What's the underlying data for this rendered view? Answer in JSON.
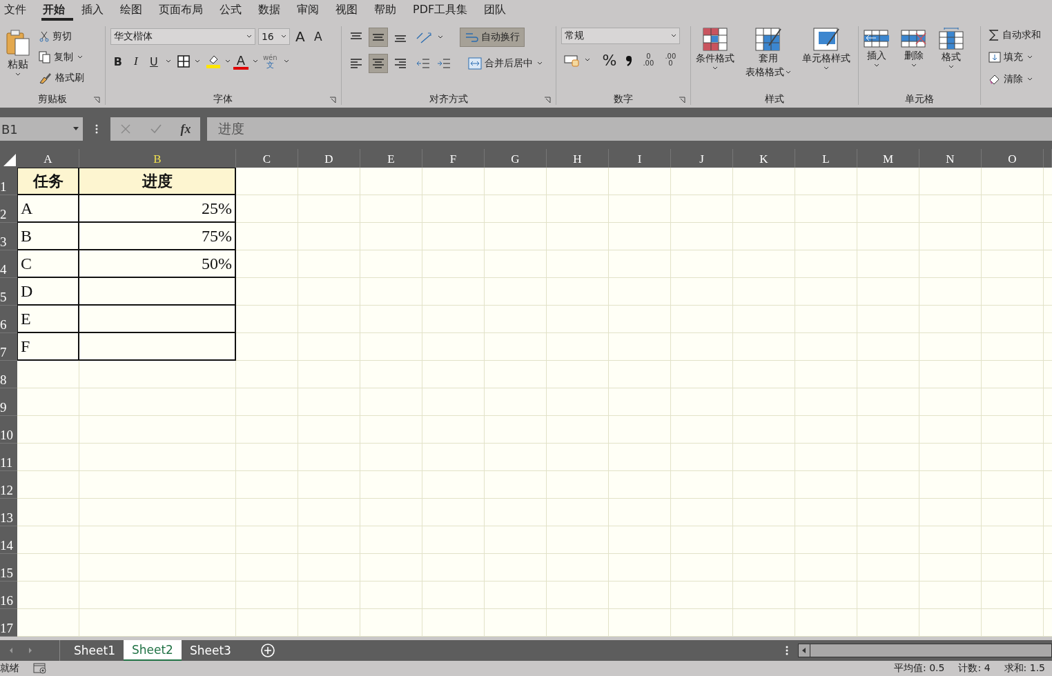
{
  "menu_tabs": [
    {
      "label": "文件",
      "selected": false
    },
    {
      "label": "开始",
      "selected": true
    },
    {
      "label": "插入",
      "selected": false
    },
    {
      "label": "绘图",
      "selected": false
    },
    {
      "label": "页面布局",
      "selected": false
    },
    {
      "label": "公式",
      "selected": false
    },
    {
      "label": "数据",
      "selected": false
    },
    {
      "label": "审阅",
      "selected": false
    },
    {
      "label": "视图",
      "selected": false
    },
    {
      "label": "帮助",
      "selected": false
    },
    {
      "label": "PDF工具集",
      "selected": false
    },
    {
      "label": "团队",
      "selected": false
    }
  ],
  "ribbon": {
    "clipboard": {
      "paste": "粘贴",
      "cut": "剪切",
      "copy": "复制",
      "format_painter": "格式刷",
      "label": "剪贴板"
    },
    "font": {
      "font_name": "华文楷体",
      "font_size": "16",
      "grow": "A",
      "shrink": "A",
      "bold": "B",
      "italic": "I",
      "underline": "U",
      "font_color": "A",
      "phonetic": "wén",
      "phonetic_char": "文",
      "label": "字体"
    },
    "alignment": {
      "vertical": [
        {
          "selected": false
        },
        {
          "selected": true
        },
        {
          "selected": false
        }
      ],
      "horizontal": [
        {
          "selected": false
        },
        {
          "selected": true
        },
        {
          "selected": false
        }
      ],
      "wrap_text": {
        "label": "自动换行",
        "selected": true
      },
      "merge_center": "合并后居中",
      "label": "对齐方式"
    },
    "number": {
      "format": "常规",
      "percent": "%",
      "increase_decimal": [
        "0",
        ".00"
      ],
      "decrease_decimal": [
        ".00",
        "0"
      ],
      "label": "数字"
    },
    "styles": {
      "conditional": "条件格式",
      "table_format": [
        "套用",
        "表格格式"
      ],
      "cell_styles": "单元格样式",
      "label": "样式"
    },
    "cells": {
      "insert": "插入",
      "delete": "删除",
      "format": "格式",
      "label": "单元格"
    },
    "editing": {
      "autosum": "自动求和",
      "fill": "填充",
      "clear": "清除"
    }
  },
  "formula_bar": {
    "name_box": "B1",
    "fx": "fx",
    "content": "进度"
  },
  "sheet": {
    "columns": [
      {
        "label": "A",
        "selected": false
      },
      {
        "label": "B",
        "selected": true
      },
      {
        "label": "C",
        "selected": false
      },
      {
        "label": "D",
        "selected": false
      },
      {
        "label": "E",
        "selected": false
      },
      {
        "label": "F",
        "selected": false
      },
      {
        "label": "G",
        "selected": false
      },
      {
        "label": "H",
        "selected": false
      },
      {
        "label": "I",
        "selected": false
      },
      {
        "label": "J",
        "selected": false
      },
      {
        "label": "K",
        "selected": false
      },
      {
        "label": "L",
        "selected": false
      },
      {
        "label": "M",
        "selected": false
      },
      {
        "label": "N",
        "selected": false
      },
      {
        "label": "O",
        "selected": false
      }
    ],
    "rows": [
      {
        "number": "1",
        "kind": "header",
        "cells": [
          "任务",
          "进度"
        ]
      },
      {
        "number": "2",
        "kind": "data",
        "cells": [
          "A",
          "25%"
        ]
      },
      {
        "number": "3",
        "kind": "data",
        "cells": [
          "B",
          "75%"
        ]
      },
      {
        "number": "4",
        "kind": "data",
        "cells": [
          "C",
          "50%"
        ]
      },
      {
        "number": "5",
        "kind": "data",
        "cells": [
          "D"
        ]
      },
      {
        "number": "6",
        "kind": "data",
        "cells": [
          "E"
        ]
      },
      {
        "number": "7",
        "kind": "data",
        "cells": [
          "F"
        ]
      },
      {
        "number": "8"
      },
      {
        "number": "9"
      },
      {
        "number": "10"
      },
      {
        "number": "11"
      },
      {
        "number": "12"
      },
      {
        "number": "13"
      },
      {
        "number": "14"
      },
      {
        "number": "15"
      },
      {
        "number": "16"
      },
      {
        "number": "17"
      }
    ]
  },
  "sheet_tabs": [
    {
      "label": "Sheet1",
      "selected": false
    },
    {
      "label": "Sheet2",
      "selected": true
    },
    {
      "label": "Sheet3",
      "selected": false
    }
  ],
  "status_bar": {
    "ready": "就绪",
    "average": "平均值: 0.5",
    "count": "计数: 4",
    "sum": "求和: 1.5"
  }
}
